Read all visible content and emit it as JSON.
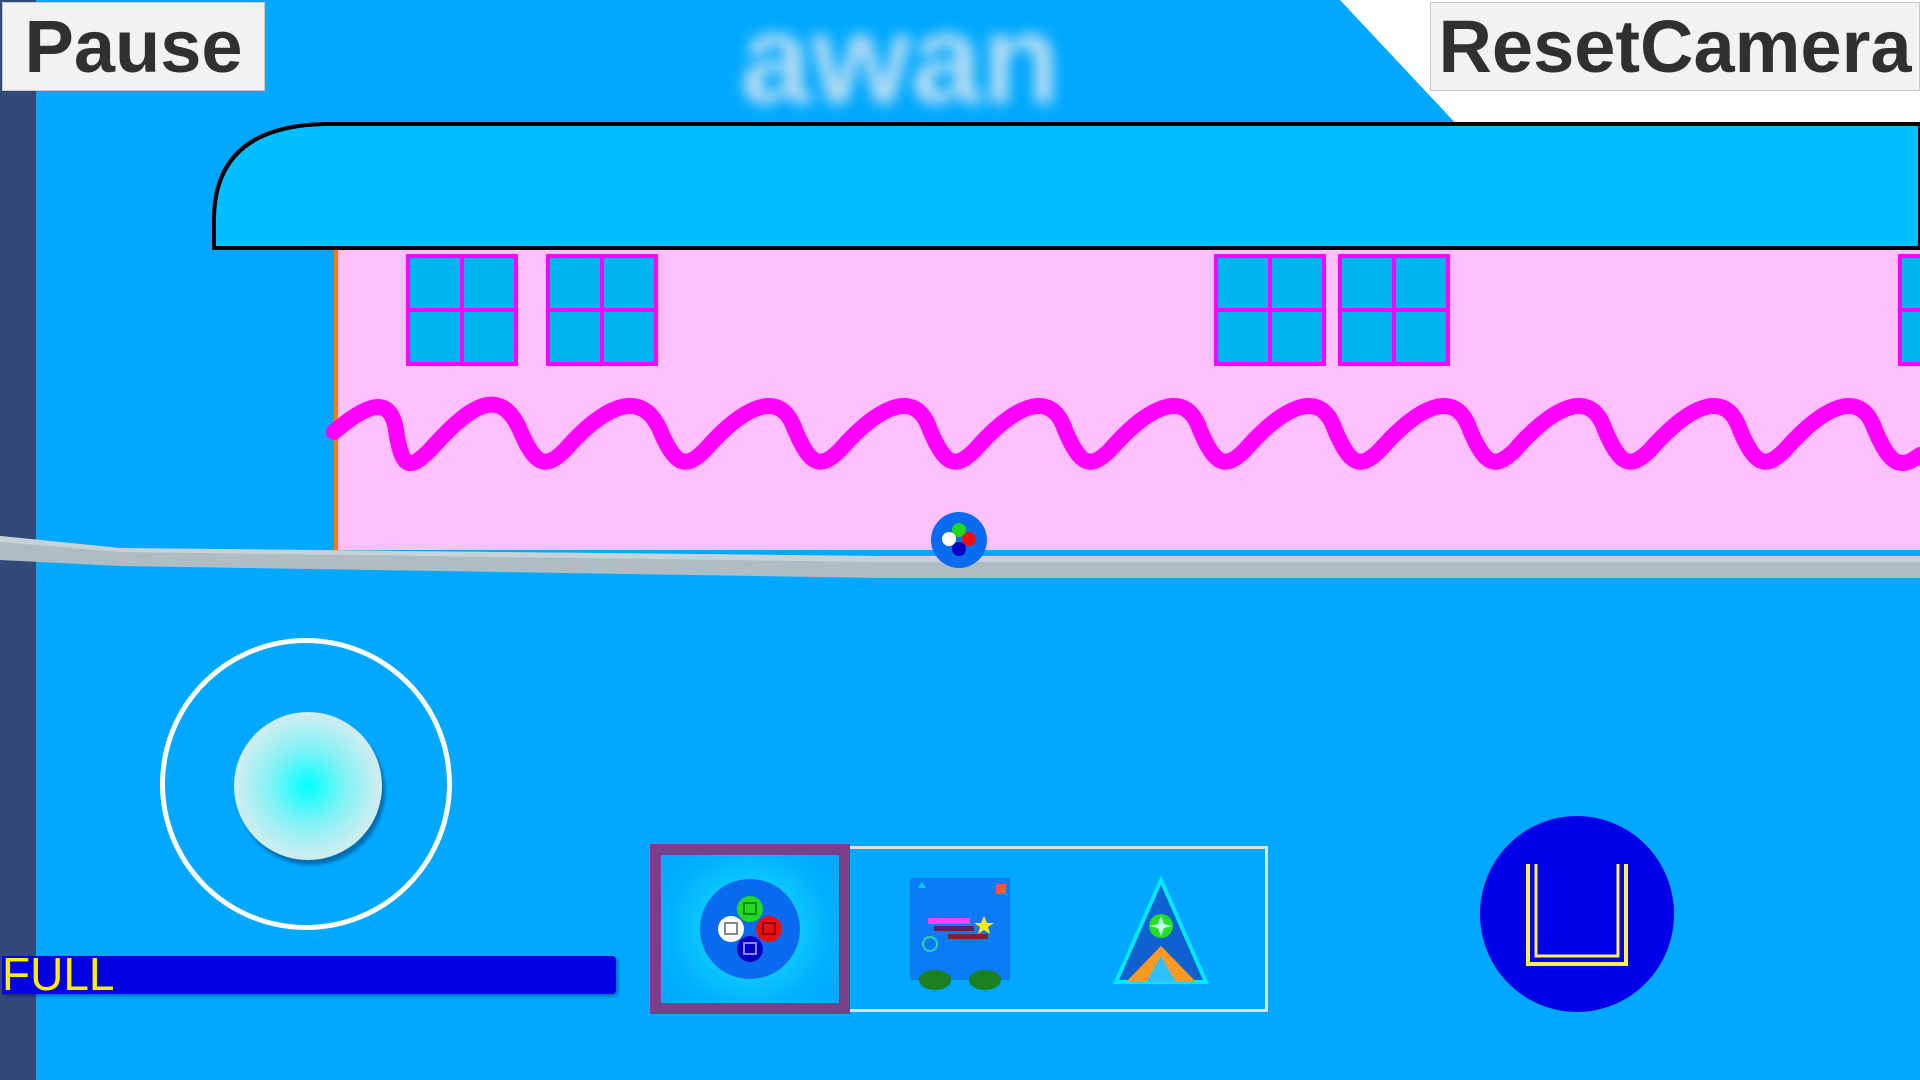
{
  "hud": {
    "pause_label": "Pause",
    "reset_camera_label": "ResetCamera",
    "energy_label": "FULL",
    "energy_level": 1.0
  },
  "scene": {
    "cloud_text": "awan",
    "sky_color": "#00a8ff",
    "roof_color": "#00bfff",
    "wall_color": "#ffc0ff",
    "wave_color": "#ff00ff",
    "window_color": "#00b4f0"
  },
  "selector": {
    "selected_index": 0,
    "items": [
      {
        "icon": "ball-character-icon"
      },
      {
        "icon": "level-map-icon"
      },
      {
        "icon": "tent-icon"
      }
    ]
  },
  "colors": {
    "accent": "#7a3f88",
    "energy_bar": "#0000e0",
    "energy_text": "#ffee00",
    "action_button": "#0000e8"
  }
}
